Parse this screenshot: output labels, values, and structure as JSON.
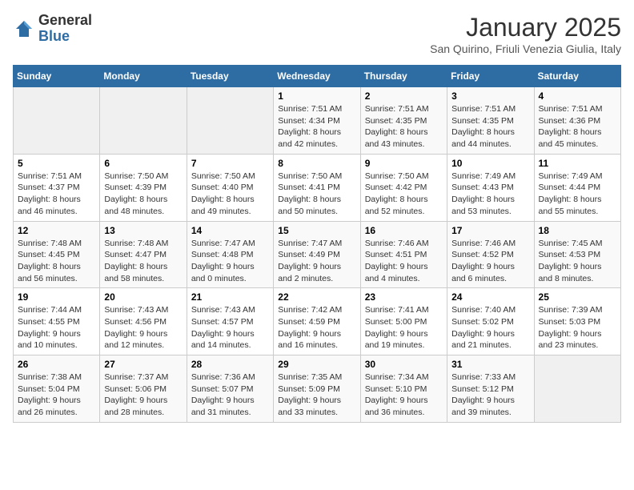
{
  "header": {
    "logo_general": "General",
    "logo_blue": "Blue",
    "month_title": "January 2025",
    "subtitle": "San Quirino, Friuli Venezia Giulia, Italy"
  },
  "days_of_week": [
    "Sunday",
    "Monday",
    "Tuesday",
    "Wednesday",
    "Thursday",
    "Friday",
    "Saturday"
  ],
  "weeks": [
    [
      {
        "day": "",
        "sunrise": "",
        "sunset": "",
        "daylight": ""
      },
      {
        "day": "",
        "sunrise": "",
        "sunset": "",
        "daylight": ""
      },
      {
        "day": "",
        "sunrise": "",
        "sunset": "",
        "daylight": ""
      },
      {
        "day": "1",
        "sunrise": "Sunrise: 7:51 AM",
        "sunset": "Sunset: 4:34 PM",
        "daylight": "Daylight: 8 hours and 42 minutes."
      },
      {
        "day": "2",
        "sunrise": "Sunrise: 7:51 AM",
        "sunset": "Sunset: 4:35 PM",
        "daylight": "Daylight: 8 hours and 43 minutes."
      },
      {
        "day": "3",
        "sunrise": "Sunrise: 7:51 AM",
        "sunset": "Sunset: 4:35 PM",
        "daylight": "Daylight: 8 hours and 44 minutes."
      },
      {
        "day": "4",
        "sunrise": "Sunrise: 7:51 AM",
        "sunset": "Sunset: 4:36 PM",
        "daylight": "Daylight: 8 hours and 45 minutes."
      }
    ],
    [
      {
        "day": "5",
        "sunrise": "Sunrise: 7:51 AM",
        "sunset": "Sunset: 4:37 PM",
        "daylight": "Daylight: 8 hours and 46 minutes."
      },
      {
        "day": "6",
        "sunrise": "Sunrise: 7:50 AM",
        "sunset": "Sunset: 4:39 PM",
        "daylight": "Daylight: 8 hours and 48 minutes."
      },
      {
        "day": "7",
        "sunrise": "Sunrise: 7:50 AM",
        "sunset": "Sunset: 4:40 PM",
        "daylight": "Daylight: 8 hours and 49 minutes."
      },
      {
        "day": "8",
        "sunrise": "Sunrise: 7:50 AM",
        "sunset": "Sunset: 4:41 PM",
        "daylight": "Daylight: 8 hours and 50 minutes."
      },
      {
        "day": "9",
        "sunrise": "Sunrise: 7:50 AM",
        "sunset": "Sunset: 4:42 PM",
        "daylight": "Daylight: 8 hours and 52 minutes."
      },
      {
        "day": "10",
        "sunrise": "Sunrise: 7:49 AM",
        "sunset": "Sunset: 4:43 PM",
        "daylight": "Daylight: 8 hours and 53 minutes."
      },
      {
        "day": "11",
        "sunrise": "Sunrise: 7:49 AM",
        "sunset": "Sunset: 4:44 PM",
        "daylight": "Daylight: 8 hours and 55 minutes."
      }
    ],
    [
      {
        "day": "12",
        "sunrise": "Sunrise: 7:48 AM",
        "sunset": "Sunset: 4:45 PM",
        "daylight": "Daylight: 8 hours and 56 minutes."
      },
      {
        "day": "13",
        "sunrise": "Sunrise: 7:48 AM",
        "sunset": "Sunset: 4:47 PM",
        "daylight": "Daylight: 8 hours and 58 minutes."
      },
      {
        "day": "14",
        "sunrise": "Sunrise: 7:47 AM",
        "sunset": "Sunset: 4:48 PM",
        "daylight": "Daylight: 9 hours and 0 minutes."
      },
      {
        "day": "15",
        "sunrise": "Sunrise: 7:47 AM",
        "sunset": "Sunset: 4:49 PM",
        "daylight": "Daylight: 9 hours and 2 minutes."
      },
      {
        "day": "16",
        "sunrise": "Sunrise: 7:46 AM",
        "sunset": "Sunset: 4:51 PM",
        "daylight": "Daylight: 9 hours and 4 minutes."
      },
      {
        "day": "17",
        "sunrise": "Sunrise: 7:46 AM",
        "sunset": "Sunset: 4:52 PM",
        "daylight": "Daylight: 9 hours and 6 minutes."
      },
      {
        "day": "18",
        "sunrise": "Sunrise: 7:45 AM",
        "sunset": "Sunset: 4:53 PM",
        "daylight": "Daylight: 9 hours and 8 minutes."
      }
    ],
    [
      {
        "day": "19",
        "sunrise": "Sunrise: 7:44 AM",
        "sunset": "Sunset: 4:55 PM",
        "daylight": "Daylight: 9 hours and 10 minutes."
      },
      {
        "day": "20",
        "sunrise": "Sunrise: 7:43 AM",
        "sunset": "Sunset: 4:56 PM",
        "daylight": "Daylight: 9 hours and 12 minutes."
      },
      {
        "day": "21",
        "sunrise": "Sunrise: 7:43 AM",
        "sunset": "Sunset: 4:57 PM",
        "daylight": "Daylight: 9 hours and 14 minutes."
      },
      {
        "day": "22",
        "sunrise": "Sunrise: 7:42 AM",
        "sunset": "Sunset: 4:59 PM",
        "daylight": "Daylight: 9 hours and 16 minutes."
      },
      {
        "day": "23",
        "sunrise": "Sunrise: 7:41 AM",
        "sunset": "Sunset: 5:00 PM",
        "daylight": "Daylight: 9 hours and 19 minutes."
      },
      {
        "day": "24",
        "sunrise": "Sunrise: 7:40 AM",
        "sunset": "Sunset: 5:02 PM",
        "daylight": "Daylight: 9 hours and 21 minutes."
      },
      {
        "day": "25",
        "sunrise": "Sunrise: 7:39 AM",
        "sunset": "Sunset: 5:03 PM",
        "daylight": "Daylight: 9 hours and 23 minutes."
      }
    ],
    [
      {
        "day": "26",
        "sunrise": "Sunrise: 7:38 AM",
        "sunset": "Sunset: 5:04 PM",
        "daylight": "Daylight: 9 hours and 26 minutes."
      },
      {
        "day": "27",
        "sunrise": "Sunrise: 7:37 AM",
        "sunset": "Sunset: 5:06 PM",
        "daylight": "Daylight: 9 hours and 28 minutes."
      },
      {
        "day": "28",
        "sunrise": "Sunrise: 7:36 AM",
        "sunset": "Sunset: 5:07 PM",
        "daylight": "Daylight: 9 hours and 31 minutes."
      },
      {
        "day": "29",
        "sunrise": "Sunrise: 7:35 AM",
        "sunset": "Sunset: 5:09 PM",
        "daylight": "Daylight: 9 hours and 33 minutes."
      },
      {
        "day": "30",
        "sunrise": "Sunrise: 7:34 AM",
        "sunset": "Sunset: 5:10 PM",
        "daylight": "Daylight: 9 hours and 36 minutes."
      },
      {
        "day": "31",
        "sunrise": "Sunrise: 7:33 AM",
        "sunset": "Sunset: 5:12 PM",
        "daylight": "Daylight: 9 hours and 39 minutes."
      },
      {
        "day": "",
        "sunrise": "",
        "sunset": "",
        "daylight": ""
      }
    ]
  ]
}
